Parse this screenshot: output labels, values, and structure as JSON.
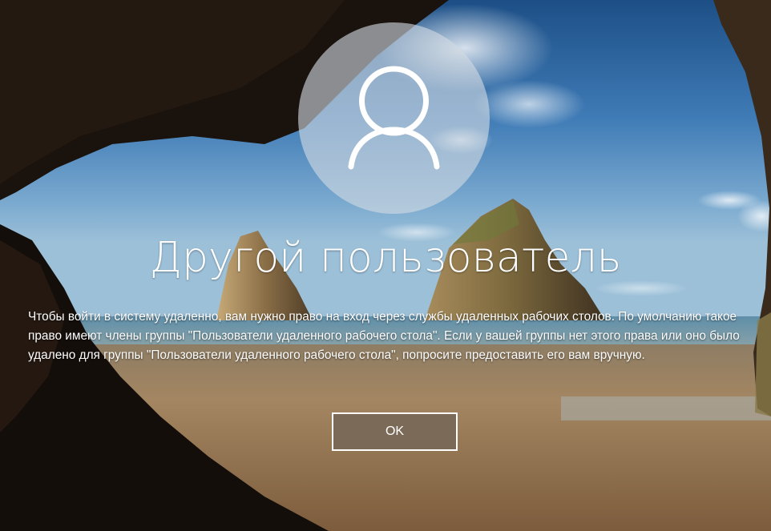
{
  "login": {
    "title": "Другой пользователь",
    "message": "Чтобы войти в систему удаленно, вам нужно право на вход через службы удаленных рабочих столов. По умолчанию такое право имеют члены группы \"Пользователи удаленного рабочего стола\". Если у вашей группы нет этого права или оно было удалено для группы \"Пользователи удаленного рабочего стола\", попросите предоставить его вам вручную.",
    "ok_label": "OK",
    "avatar_icon": "user-silhouette-icon"
  },
  "colors": {
    "sky_top": "#1f5a96",
    "sky_mid": "#5a92c4",
    "sea": "#6f9fb6",
    "sand": "#9a7a52",
    "cave": "#1b1410",
    "button_bg": "#786858",
    "text": "#ffffff"
  }
}
